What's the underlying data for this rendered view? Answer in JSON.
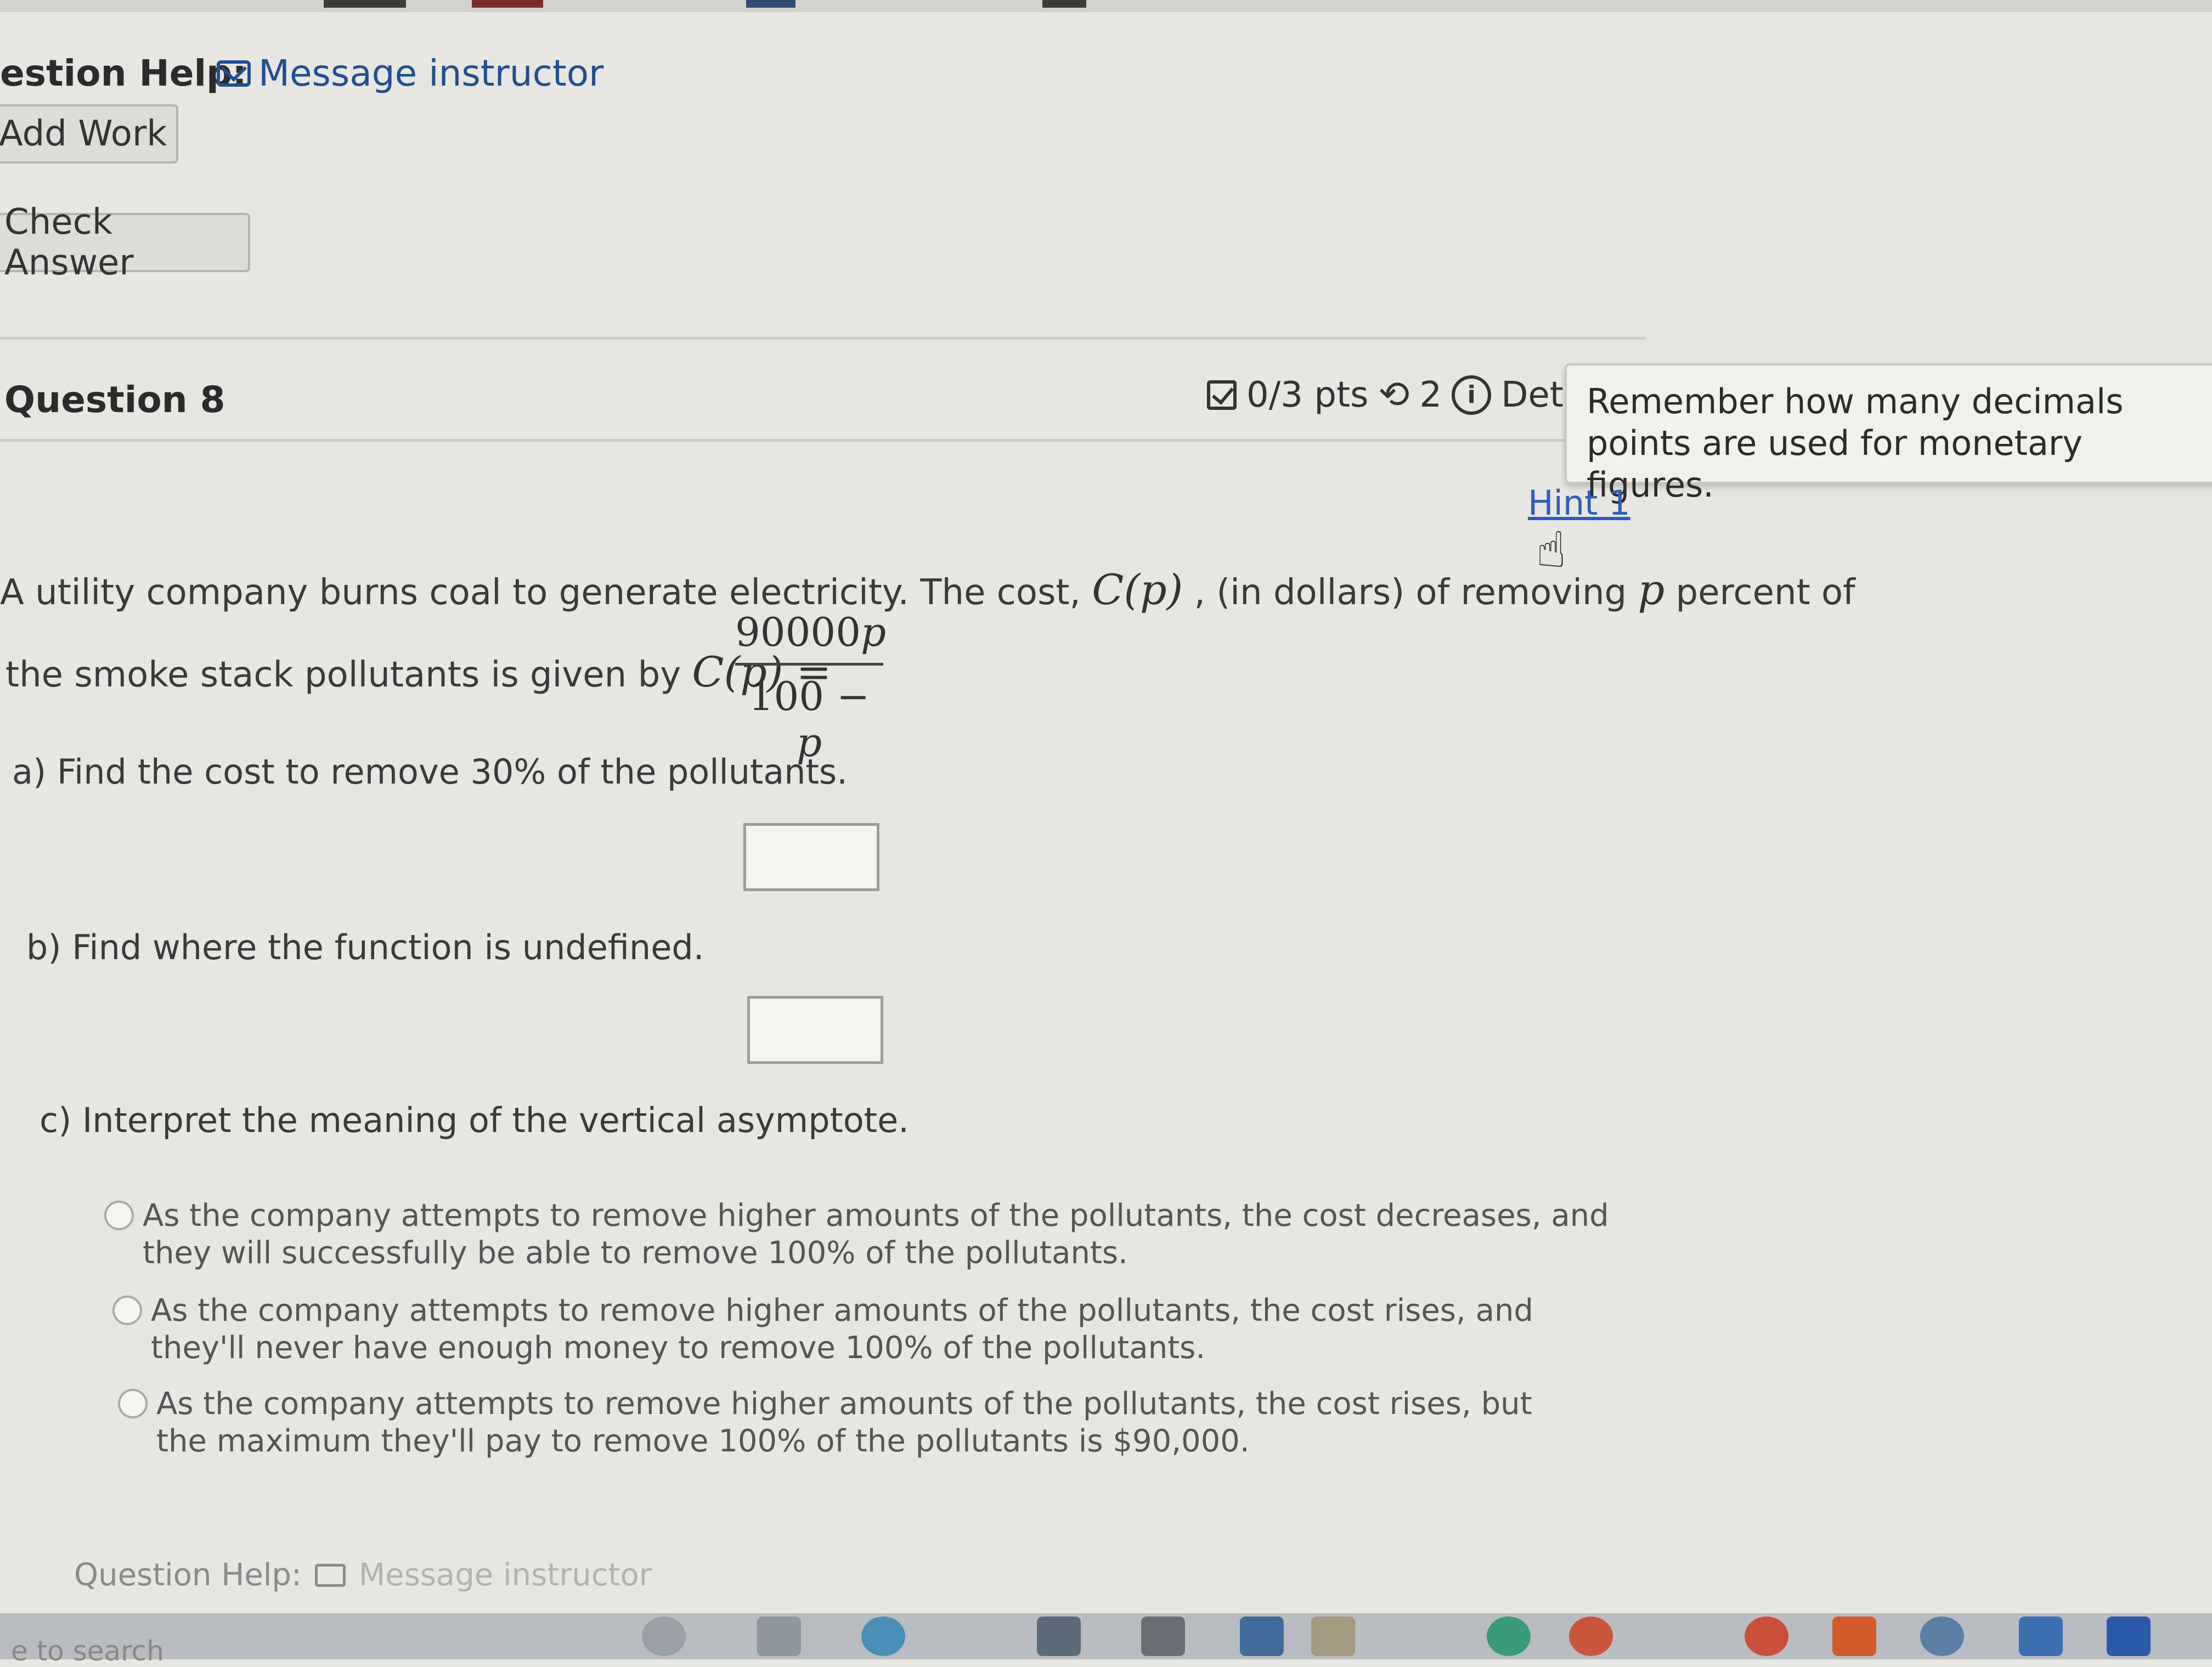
{
  "header": {
    "help_label": "estion Help:",
    "message_instructor": "Message instructor",
    "add_work": "Add Work",
    "check_answer": "Check Answer"
  },
  "question": {
    "title": "Question 8",
    "score": "0/3 pts",
    "retries": "2",
    "details_text": "Det",
    "tooltip": "Remember how many decimals points are used for monetary figures.",
    "hint": "Hint 1"
  },
  "problem": {
    "line1_pre": "A utility company burns coal to generate electricity. The cost,",
    "cp": "C(p)",
    "line1_mid": ", (in dollars) of removing",
    "p": "p",
    "line1_post": "percent of",
    "line2_pre": "the smoke stack pollutants is given by",
    "eq": "C(p) =",
    "numerator": "90000",
    "numerator_var": "p",
    "denominator": "100 −",
    "denominator_var": "p",
    "a": "a) Find the cost to remove 30% of the pollutants.",
    "b": "b) Find where the function is undefined.",
    "c": "c) Interpret the meaning of the vertical asymptote.",
    "options": [
      "As the company attempts to remove higher amounts of the pollutants, the cost decreases, and they will successfully be able to remove 100% of the pollutants.",
      "As the company attempts to remove higher amounts of the pollutants, the cost rises, and they'll never have enough money to remove 100% of the pollutants.",
      "As the company attempts to remove higher amounts of the pollutants, the cost rises, but the maximum they'll pay to remove 100% of the pollutants is $90,000."
    ]
  },
  "footer": {
    "help_label": "Question Help:",
    "message_instructor": "Message instructor",
    "search": "e to search"
  },
  "colors": {
    "link": "#1f4f91",
    "hint": "#2c5fb8",
    "page_bg": "#e7e6e2"
  }
}
